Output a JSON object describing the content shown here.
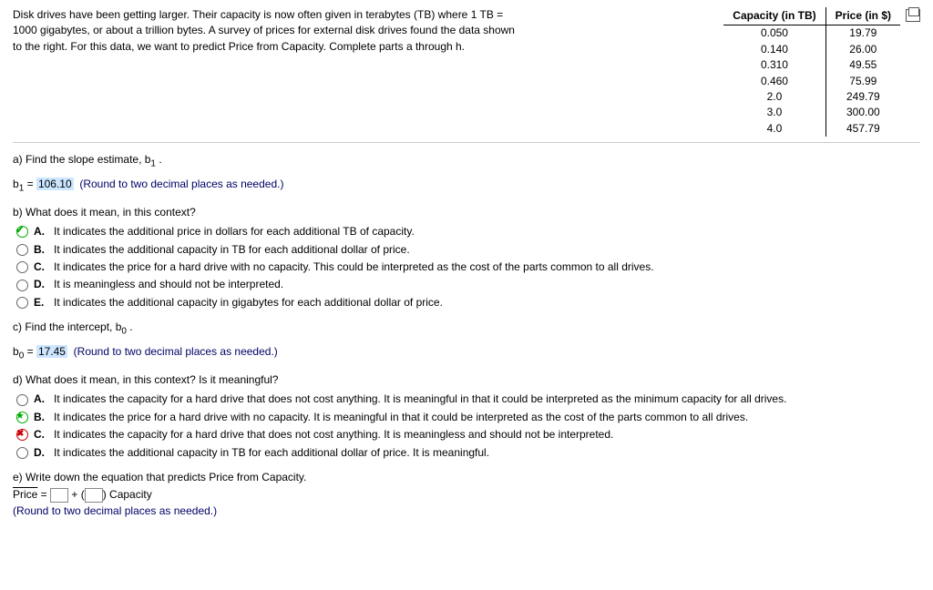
{
  "intro": "Disk drives have been getting larger. Their capacity is now often given in terabytes (TB) where 1 TB = 1000 gigabytes, or about a trillion bytes. A survey of prices for external disk drives found the data shown to the right. For this data, we want to predict Price from Capacity. Complete parts a through h.",
  "table": {
    "headers": [
      "Capacity (in TB)",
      "Price (in $)"
    ],
    "rows": [
      [
        "0.050",
        "19.79"
      ],
      [
        "0.140",
        "26.00"
      ],
      [
        "0.310",
        "49.55"
      ],
      [
        "0.460",
        "75.99"
      ],
      [
        "2.0",
        "249.79"
      ],
      [
        "3.0",
        "300.00"
      ],
      [
        "4.0",
        "457.79"
      ]
    ]
  },
  "a": {
    "prompt": "a) Find the slope estimate, b",
    "sub": "1",
    "var": "b",
    "eq": " = ",
    "value": "106.10",
    "hint": "(Round to two decimal places as needed.)"
  },
  "b": {
    "prompt": "b) What does it mean, in this context?",
    "options": [
      "It indicates the additional price in dollars for each additional TB of capacity.",
      "It indicates the additional capacity in TB for each additional dollar of price.",
      "It indicates the price for a hard drive with no capacity. This could be interpreted as the cost of the parts common to all drives.",
      "It is meaningless and should not be interpreted.",
      "It indicates the additional capacity in gigabytes for each additional dollar of price."
    ],
    "letters": [
      "A.",
      "B.",
      "C.",
      "D.",
      "E."
    ]
  },
  "c": {
    "prompt": "c) Find the intercept, b",
    "sub": "0",
    "var": "b",
    "eq": " = ",
    "value": "17.45",
    "hint": "(Round to two decimal places as needed.)"
  },
  "d": {
    "prompt": "d) What does it mean, in this context? Is it meaningful?",
    "options": [
      "It indicates the capacity for a hard drive that does not cost anything. It is meaningful in that it could be interpreted as the minimum capacity for all drives.",
      "It indicates the price for a hard drive with no capacity. It is meaningful in that it could be interpreted as the cost of the parts common to all drives.",
      "It indicates the capacity for a hard drive that does not cost anything. It is meaningless and should not be interpreted.",
      "It indicates the additional capacity in TB for each additional dollar of price. It is meaningful."
    ],
    "letters": [
      "A.",
      "B.",
      "C.",
      "D."
    ]
  },
  "e": {
    "prompt": "e) Write down the equation that predicts Price from Capacity.",
    "lhs": "Price",
    "eq": " = ",
    "plus": " + (",
    "close": ") ",
    "rhs": "Capacity",
    "hint": "(Round to two decimal places as needed.)"
  }
}
